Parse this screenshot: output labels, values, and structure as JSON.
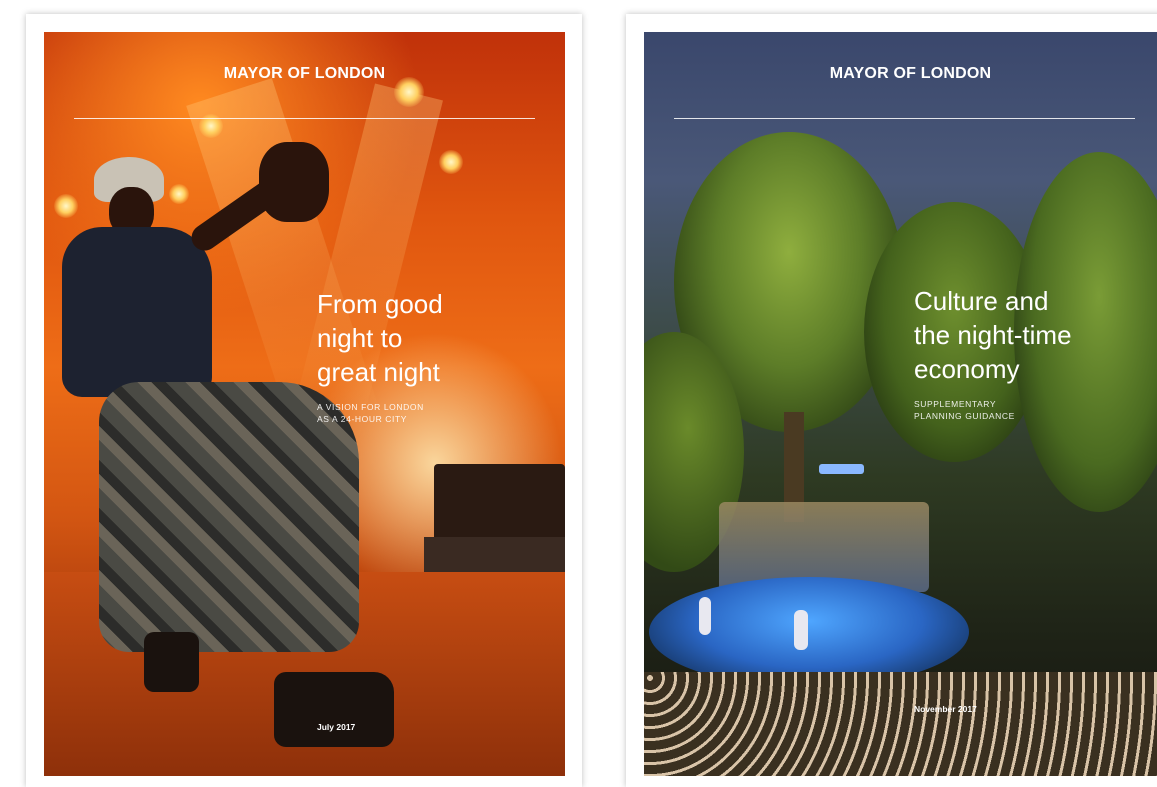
{
  "covers": [
    {
      "masthead": "MAYOR OF LONDON",
      "title_lines": [
        "From good",
        "night to",
        "great night"
      ],
      "subtitle_lines": [
        "A VISION FOR LONDON",
        "AS A 24-HOUR CITY"
      ],
      "date": "July 2017"
    },
    {
      "masthead": "MAYOR OF LONDON",
      "title_lines": [
        "Culture and",
        "the night-time",
        "economy"
      ],
      "subtitle_lines": [
        "SUPPLEMENTARY",
        "PLANNING GUIDANCE"
      ],
      "date": "November 2017"
    }
  ]
}
